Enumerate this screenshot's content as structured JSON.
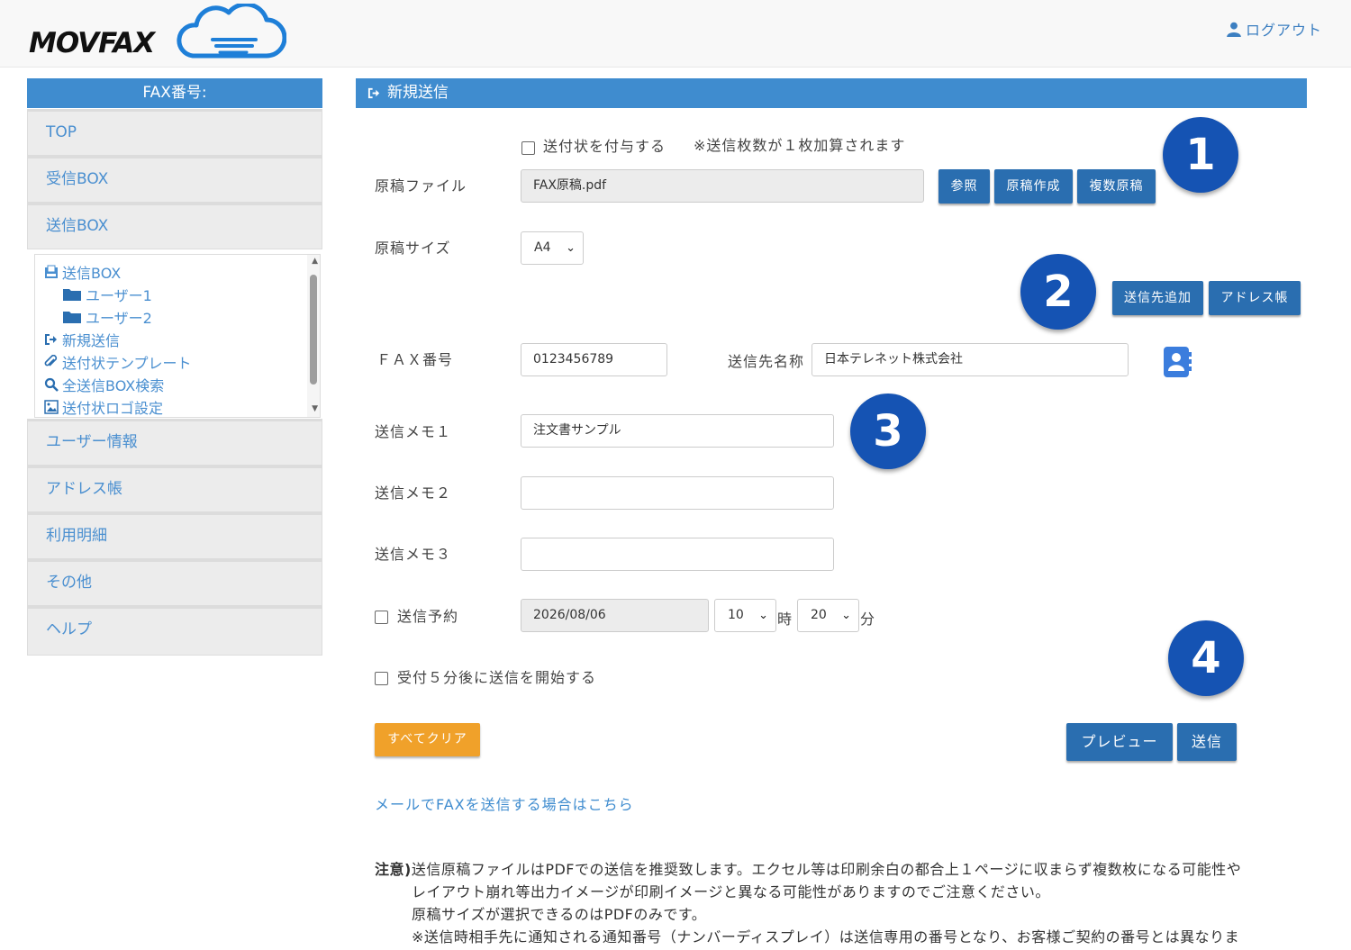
{
  "header": {
    "logo_text": "MOVFAX",
    "logout_label": "ログアウト"
  },
  "sidebar": {
    "title": "FAX番号:",
    "items_top": [
      {
        "label": "TOP"
      },
      {
        "label": "受信BOX"
      },
      {
        "label": "送信BOX"
      }
    ],
    "tree": [
      {
        "label": "送信BOX",
        "icon": "inbox-icon"
      },
      {
        "label": "ユーザー1",
        "icon": "folder-icon"
      },
      {
        "label": "ユーザー2",
        "icon": "folder-icon"
      },
      {
        "label": "新規送信",
        "icon": "sign-out-icon"
      },
      {
        "label": "送付状テンプレート",
        "icon": "paperclip-icon"
      },
      {
        "label": "全送信BOX検索",
        "icon": "search-icon"
      },
      {
        "label": "送付状ロゴ設定",
        "icon": "image-icon"
      }
    ],
    "items_bottom": [
      {
        "label": "ユーザー情報"
      },
      {
        "label": "アドレス帳"
      },
      {
        "label": "利用明細"
      },
      {
        "label": "その他"
      },
      {
        "label": "ヘルプ"
      }
    ]
  },
  "main": {
    "title": "新規送信",
    "cover_checkbox_label": "送付状を付与する",
    "cover_note": "※送信枚数が１枚加算されます",
    "file_label": "原稿ファイル",
    "file_value": "FAX原稿.pdf",
    "btn_browse": "参照",
    "btn_create": "原稿作成",
    "btn_multi": "複数原稿",
    "size_label": "原稿サイズ",
    "size_value": "A4",
    "btn_add_dest": "送信先追加",
    "btn_address_book": "アドレス帳",
    "fax_label": "ＦＡＸ番号",
    "fax_value": "0123456789",
    "dest_name_label": "送信先名称",
    "dest_name_value": "日本テレネット株式会社",
    "memo1_label": "送信メモ１",
    "memo1_value": "注文書サンプル",
    "memo2_label": "送信メモ２",
    "memo2_value": "",
    "memo3_label": "送信メモ３",
    "memo3_value": "",
    "schedule_label": "送信予約",
    "schedule_date": "2026/08/06",
    "schedule_hour": "10",
    "hour_unit": "時",
    "schedule_min": "20",
    "min_unit": "分",
    "delay_label": "受付５分後に送信を開始する",
    "btn_clear": "すべてクリア",
    "btn_preview": "プレビュー",
    "btn_send": "送信",
    "mail_link": "メールでFAXを送信する場合はこちら",
    "note_prefix": "注意)",
    "notes": [
      "送信原稿ファイルはPDFでの送信を推奨致します。エクセル等は印刷余白の都合上１ページに収まらず複数枚になる可能性や",
      "レイアウト崩れ等出力イメージが印刷イメージと異なる可能性がありますのでご注意ください。",
      "原稿サイズが選択できるのはPDFのみです。",
      "※送信時相手先に通知される通知番号（ナンバーディスプレイ）は送信専用の番号となり、お客様ご契約の番号とは異なりま"
    ]
  },
  "markers": [
    "1",
    "2",
    "3",
    "4"
  ],
  "colors": {
    "header_blue": "#3f8ccf",
    "button_blue": "#2a6eb0",
    "marker_blue": "#1553b3",
    "clear_orange": "#f0a12a"
  }
}
